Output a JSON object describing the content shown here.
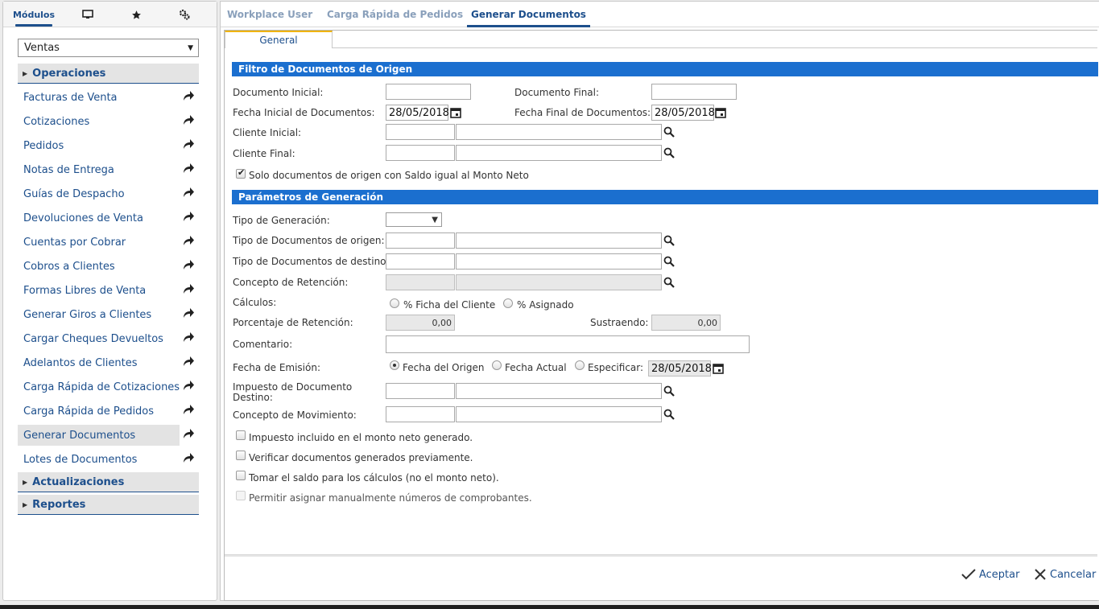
{
  "left_tabs": {
    "modules_label": "Módulos",
    "monitor_icon": "monitor-icon",
    "star_icon": "star-icon",
    "settings_icon": "gears-icon"
  },
  "module_select": {
    "value": "Ventas"
  },
  "sections": [
    {
      "label": "Operaciones",
      "expanded": true
    },
    {
      "label": "Actualizaciones",
      "expanded": false
    },
    {
      "label": "Reportes",
      "expanded": false
    }
  ],
  "nav_items": [
    "Facturas de Venta",
    "Cotizaciones",
    "Pedidos",
    "Notas de Entrega",
    "Guías de Despacho",
    "Devoluciones de Venta",
    "Cuentas por Cobrar",
    "Cobros a Clientes",
    "Formas Libres de Venta",
    "Generar Giros a Clientes",
    "Cargar Cheques Devueltos",
    "Adelantos de Clientes",
    "Carga Rápida de Cotizaciones",
    "Carga Rápida de Pedidos",
    "Generar Documentos",
    "Lotes de Documentos"
  ],
  "selected_nav": "Generar Documentos",
  "top_tabs": [
    "Workplace User",
    "Carga Rápida de Pedidos",
    "Generar Documentos"
  ],
  "active_top_tab": "Generar Documentos",
  "inner_tab": "General",
  "filtro": {
    "title": "Filtro de Documentos de Origen",
    "doc_inicial_label": "Documento Inicial:",
    "doc_inicial_value": "",
    "doc_final_label": "Documento Final:",
    "doc_final_value": "",
    "fecha_inicial_label": "Fecha Inicial de Documentos:",
    "fecha_inicial_value": "28/05/2018",
    "fecha_final_label": "Fecha Final de Documentos:",
    "fecha_final_value": "28/05/2018",
    "cliente_inicial_label": "Cliente Inicial:",
    "cliente_final_label": "Cliente Final:",
    "solo_saldo_label": "Solo documentos de origen con Saldo igual al Monto Neto",
    "solo_saldo_checked": true
  },
  "parametros": {
    "title": "Parámetros de Generación",
    "tipo_generacion_label": "Tipo de Generación:",
    "tipo_generacion_value": "",
    "tipo_doc_origen_label": "Tipo de Documentos de origen:",
    "tipo_doc_destino_label": "Tipo de Documentos de destino:",
    "concepto_retencion_label": "Concepto de Retención:",
    "calculos_label": "Cálculos:",
    "calculos_options": [
      "% Ficha del Cliente",
      "% Asignado"
    ],
    "porcentaje_label": "Porcentaje de Retención:",
    "porcentaje_value": "0,00",
    "sustraendo_label": "Sustraendo:",
    "sustraendo_value": "0,00",
    "comentario_label": "Comentario:",
    "comentario_value": "",
    "fecha_emision_label": "Fecha de Emisión:",
    "fecha_emision_options": [
      "Fecha del Origen",
      "Fecha Actual",
      "Especificar:"
    ],
    "fecha_emision_selected": "Fecha del Origen",
    "fecha_emision_value": "28/05/2018",
    "impuesto_label": "Impuesto de Documento Destino:",
    "concepto_mov_label": "Concepto de Movimiento:",
    "checkboxes": [
      {
        "label": "Impuesto incluido en el monto neto generado.",
        "checked": false,
        "enabled": true
      },
      {
        "label": "Verificar documentos generados previamente.",
        "checked": false,
        "enabled": true
      },
      {
        "label": "Tomar el saldo para los cálculos (no el monto neto).",
        "checked": false,
        "enabled": true
      },
      {
        "label": "Permitir asignar manualmente números de comprobantes.",
        "checked": false,
        "enabled": false
      }
    ]
  },
  "footer": {
    "accept_label": "Aceptar",
    "cancel_label": "Cancelar"
  }
}
